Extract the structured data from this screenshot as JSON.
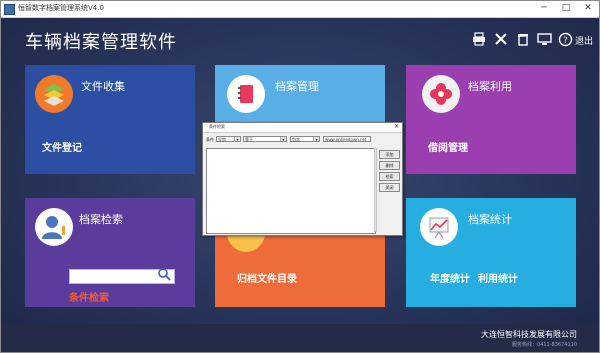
{
  "window": {
    "title": "恒智数字档案管理系统V4.0",
    "controls": {
      "minimize": "─",
      "maximize": "□",
      "close": "✕"
    }
  },
  "app": {
    "title": "车辆档案管理软件"
  },
  "toolbar": {
    "icons": [
      "printer-icon",
      "tools-icon",
      "trash-icon",
      "monitor-icon",
      "help-icon"
    ],
    "exit_label": "退出"
  },
  "tiles": {
    "file_collection": {
      "title": "文件收集",
      "sub": "文件登记",
      "color": "#2c4fa3"
    },
    "archive_management": {
      "title": "档案管理",
      "color": "#5aaee6"
    },
    "archive_use": {
      "title": "档案利用",
      "sub": "借阅管理",
      "color": "#9b3fb0"
    },
    "archive_search": {
      "title": "档案检索",
      "sub": "条件检索",
      "search_value": "",
      "color": "#5a3c9c"
    },
    "archive_catalog": {
      "sub": "归档文件目录",
      "color": "#ee6b3a"
    },
    "archive_statistics": {
      "title": "档案统计",
      "sub1": "年度统计",
      "sub2": "利用统计",
      "color": "#27aee0"
    }
  },
  "dialog": {
    "title": "条件检索",
    "field_label": "条件",
    "select1": "全宗",
    "select2": "等于",
    "select3": "包含",
    "input_value": "www.onlinedown.net",
    "buttons": [
      "添加",
      "删除",
      "检索",
      "关闭"
    ]
  },
  "footer": {
    "company": "大连恒智科技发展有限公司",
    "phone": "服务热线：0411-83674110"
  }
}
